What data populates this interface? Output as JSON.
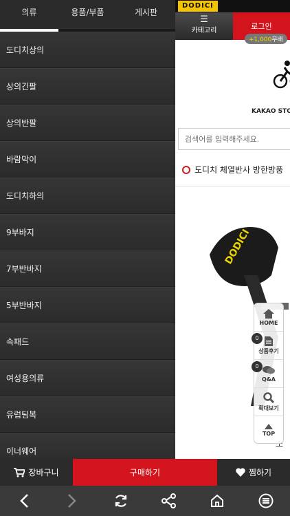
{
  "drawer": {
    "tabs": [
      {
        "label": "의류"
      },
      {
        "label": "용품/부품"
      },
      {
        "label": "게시판"
      }
    ],
    "items": [
      {
        "label": "도디치상의"
      },
      {
        "label": "상의긴팔"
      },
      {
        "label": "상의반팔"
      },
      {
        "label": "바람막이"
      },
      {
        "label": "도디치하의"
      },
      {
        "label": "9부바지"
      },
      {
        "label": "7부반바지"
      },
      {
        "label": "5부반바지"
      },
      {
        "label": "속패드"
      },
      {
        "label": "여성용의류"
      },
      {
        "label": "유럽팀복"
      },
      {
        "label": "이너웨어"
      }
    ]
  },
  "page": {
    "brand": "DODICI",
    "nav_category_label": "카테고리",
    "nav_login_label": "로그인",
    "point_badge_value": "+1,000",
    "point_badge_suffix": "무배",
    "kakao_label": "KAKAO STOR",
    "search_placeholder": "검색어를 입력해주세요.",
    "product_title": "도디치 체열반사 방한방풍",
    "product_caption": "소",
    "product_image_text": "DODICI"
  },
  "quick_menu": {
    "items": [
      {
        "label": "HOME",
        "icon": "home-icon"
      },
      {
        "label": "상품후기",
        "icon": "document-icon",
        "count": "0"
      },
      {
        "label": "Q&A",
        "icon": "chat-icon",
        "count": "0"
      },
      {
        "label": "확대보기",
        "icon": "magnifier-icon"
      },
      {
        "label": "TOP",
        "icon": "arrow-up-icon"
      }
    ]
  },
  "action_bar": {
    "cart_label": "장바구니",
    "buy_label": "구매하기",
    "wish_label": "찜하기"
  },
  "colors": {
    "accent_red": "#d3141c",
    "drawer_bg": "#2d2d2d",
    "brand_yellow": "#f5c400"
  }
}
